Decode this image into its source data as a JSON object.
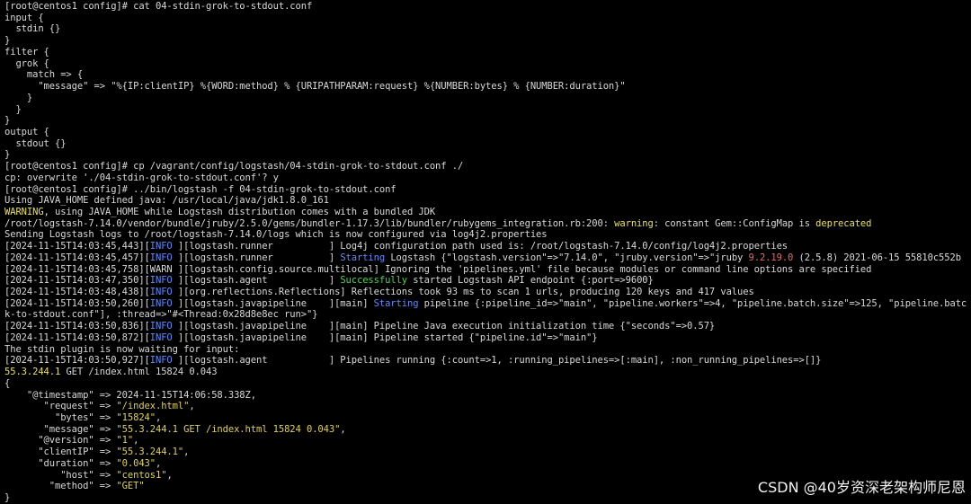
{
  "colors": {
    "default": "#d8d8d8",
    "info": "#5b8cff",
    "warning": "#e8e05a",
    "success": "#4cd94c",
    "red": "#e06a6a",
    "string": "#e0d24a",
    "background": "#000000"
  },
  "terminal": {
    "lines": [
      [
        {
          "t": "[root@centos1 config]# cat 04-stdin-grok-to-stdout.conf",
          "c": "default"
        }
      ],
      [
        {
          "t": "input {",
          "c": "default"
        }
      ],
      [
        {
          "t": "  stdin {}",
          "c": "default"
        }
      ],
      [
        {
          "t": "}",
          "c": "default"
        }
      ],
      [
        {
          "t": "filter {",
          "c": "default"
        }
      ],
      [
        {
          "t": "  grok {",
          "c": "default"
        }
      ],
      [
        {
          "t": "    match => {",
          "c": "default"
        }
      ],
      [
        {
          "t": "      \"message\" => \"%{IP:clientIP} %{WORD:method} % {URIPATHPARAM:request} %{NUMBER:bytes} % {NUMBER:duration}\"",
          "c": "default"
        }
      ],
      [
        {
          "t": "    }",
          "c": "default"
        }
      ],
      [
        {
          "t": "  }",
          "c": "default"
        }
      ],
      [
        {
          "t": "}",
          "c": "default"
        }
      ],
      [
        {
          "t": "output {",
          "c": "default"
        }
      ],
      [
        {
          "t": "  stdout {}",
          "c": "default"
        }
      ],
      [
        {
          "t": "}",
          "c": "default"
        }
      ],
      [
        {
          "t": "[root@centos1 config]# cp /vagrant/config/logstash/04-stdin-grok-to-stdout.conf ./",
          "c": "default"
        }
      ],
      [
        {
          "t": "cp: overwrite './04-stdin-grok-to-stdout.conf'? y",
          "c": "default"
        }
      ],
      [
        {
          "t": "[root@centos1 config]# ../bin/logstash -f 04-stdin-grok-to-stdout.conf",
          "c": "default"
        }
      ],
      [
        {
          "t": "Using JAVA_HOME defined java: /usr/local/java/jdk1.8.0_161",
          "c": "default"
        }
      ],
      [
        {
          "t": "WARNING",
          "c": "warning"
        },
        {
          "t": ", using JAVA_HOME while Logstash distribution comes with a bundled JDK",
          "c": "default"
        }
      ],
      [
        {
          "t": "/root/logstash-7.14.0/vendor/bundle/jruby/2.5.0/gems/bundler-1.17.3/lib/bundler/rubygems_integration.rb:200: ",
          "c": "default"
        },
        {
          "t": "warning",
          "c": "warning"
        },
        {
          "t": ": constant Gem::ConfigMap is ",
          "c": "default"
        },
        {
          "t": "deprecated",
          "c": "warning"
        }
      ],
      [
        {
          "t": "Sending Logstash logs to /root/logstash-7.14.0/logs which is now configured via log4j2.properties",
          "c": "default"
        }
      ],
      [
        {
          "t": "[2024-11-15T14:03:45,443][",
          "c": "default"
        },
        {
          "t": "INFO",
          "c": "info"
        },
        {
          "t": " ][logstash.runner          ] Log4j configuration path used is: /root/logstash-7.14.0/config/log4j2.properties",
          "c": "default"
        }
      ],
      [
        {
          "t": "[2024-11-15T14:03:45,457][",
          "c": "default"
        },
        {
          "t": "INFO",
          "c": "info"
        },
        {
          "t": " ][logstash.runner          ] ",
          "c": "default"
        },
        {
          "t": "Starting",
          "c": "info"
        },
        {
          "t": " Logstash {\"logstash.version\"=>\"7.14.0\", \"jruby.version\"=>\"jruby ",
          "c": "default"
        },
        {
          "t": "9.2.19.0",
          "c": "red"
        },
        {
          "t": " (2.5.8) 2021-06-15 55810c552b",
          "c": "default"
        }
      ],
      [
        {
          "t": "[2024-11-15T14:03:45,758][WARN ][logstash.config.source.multilocal] Ignoring the 'pipelines.yml' file because modules or command line options are specified",
          "c": "default"
        }
      ],
      [
        {
          "t": "[2024-11-15T14:03:47,350][",
          "c": "default"
        },
        {
          "t": "INFO",
          "c": "info"
        },
        {
          "t": " ][logstash.agent           ] ",
          "c": "default"
        },
        {
          "t": "Successfully",
          "c": "success"
        },
        {
          "t": " started Logstash API endpoint {:port=>9600}",
          "c": "default"
        }
      ],
      [
        {
          "t": "[2024-11-15T14:03:48,438][",
          "c": "default"
        },
        {
          "t": "INFO",
          "c": "info"
        },
        {
          "t": " ][org.reflections.Reflections] Reflections took 93 ms to scan 1 urls, producing 120 keys and 417 values",
          "c": "default"
        }
      ],
      [
        {
          "t": "[2024-11-15T14:03:50,260][",
          "c": "default"
        },
        {
          "t": "INFO",
          "c": "info"
        },
        {
          "t": " ][logstash.javapipeline    ][main] ",
          "c": "default"
        },
        {
          "t": "Starting",
          "c": "info"
        },
        {
          "t": " pipeline {:pipeline_id=>\"main\", \"pipeline.workers\"=>4, \"pipeline.batch.size\"=>125, \"pipeline.batc",
          "c": "default"
        }
      ],
      [
        {
          "t": "k-to-stdout.conf\"], :thread=>\"#<Thread:0x28d8e8ec run>\"}",
          "c": "default"
        }
      ],
      [
        {
          "t": "[2024-11-15T14:03:50,836][",
          "c": "default"
        },
        {
          "t": "INFO",
          "c": "info"
        },
        {
          "t": " ][logstash.javapipeline    ][main] Pipeline Java execution initialization time {\"seconds\"=>0.57}",
          "c": "default"
        }
      ],
      [
        {
          "t": "[2024-11-15T14:03:50,872][",
          "c": "default"
        },
        {
          "t": "INFO",
          "c": "info"
        },
        {
          "t": " ][logstash.javapipeline    ][main] Pipeline started {\"pipeline.id\"=>\"main\"}",
          "c": "default"
        }
      ],
      [
        {
          "t": "The stdin plugin is now waiting for input:",
          "c": "default"
        }
      ],
      [
        {
          "t": "[2024-11-15T14:03:50,927][",
          "c": "default"
        },
        {
          "t": "INFO",
          "c": "info"
        },
        {
          "t": " ][logstash.agent           ] Pipelines running {:count=>1, :running_pipelines=>[:main], :non_running_pipelines=>[]}",
          "c": "default"
        }
      ],
      [
        {
          "t": "55.3.244.1",
          "c": "warning"
        },
        {
          "t": " GET /index.html 15824 0.043",
          "c": "default"
        }
      ],
      [
        {
          "t": "{",
          "c": "default"
        }
      ],
      [
        {
          "t": "    \"@timestamp\" => 2024-11-15T14:06:58.338Z,",
          "c": "default"
        }
      ],
      [
        {
          "t": "       \"request\" => ",
          "c": "default"
        },
        {
          "t": "\"/index.html\"",
          "c": "string"
        },
        {
          "t": ",",
          "c": "default"
        }
      ],
      [
        {
          "t": "         \"bytes\" => ",
          "c": "default"
        },
        {
          "t": "\"15824\"",
          "c": "string"
        },
        {
          "t": ",",
          "c": "default"
        }
      ],
      [
        {
          "t": "       \"message\" => ",
          "c": "default"
        },
        {
          "t": "\"55.3.244.1 GET /index.html 15824 0.043\"",
          "c": "string"
        },
        {
          "t": ",",
          "c": "default"
        }
      ],
      [
        {
          "t": "      \"@version\" => ",
          "c": "default"
        },
        {
          "t": "\"1\"",
          "c": "string"
        },
        {
          "t": ",",
          "c": "default"
        }
      ],
      [
        {
          "t": "      \"clientIP\" => ",
          "c": "default"
        },
        {
          "t": "\"55.3.244.1\"",
          "c": "string"
        },
        {
          "t": ",",
          "c": "default"
        }
      ],
      [
        {
          "t": "      \"duration\" => ",
          "c": "default"
        },
        {
          "t": "\"0.043\"",
          "c": "string"
        },
        {
          "t": ",",
          "c": "default"
        }
      ],
      [
        {
          "t": "          \"host\" => ",
          "c": "default"
        },
        {
          "t": "\"centos1\"",
          "c": "string"
        },
        {
          "t": ",",
          "c": "default"
        }
      ],
      [
        {
          "t": "        \"method\" => ",
          "c": "default"
        },
        {
          "t": "\"GET\"",
          "c": "string"
        }
      ],
      [
        {
          "t": "}",
          "c": "default"
        }
      ]
    ]
  },
  "watermark": {
    "text": "CSDN @40岁资深老架构师尼恩"
  }
}
